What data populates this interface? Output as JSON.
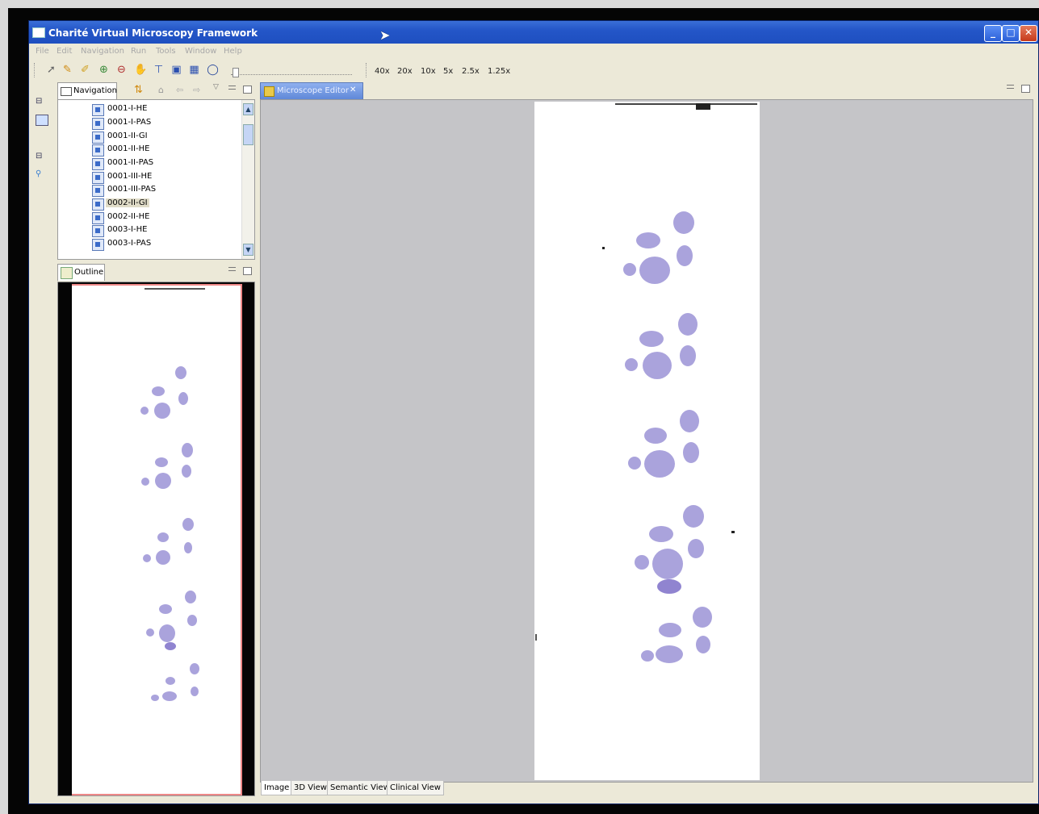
{
  "window": {
    "title": "Charité Virtual Microscopy Framework",
    "controls": {
      "minimize": "_",
      "maximize": "□",
      "close": "✕"
    }
  },
  "menu": [
    "File",
    "Edit",
    "Navigation",
    "Run",
    "Tools",
    "Window",
    "Help"
  ],
  "toolbar": {
    "icons": [
      "select-arrow-icon",
      "pencil-icon",
      "multi-pencil-icon",
      "zoom-in-icon",
      "zoom-out-icon",
      "hand-pan-icon",
      "stamp-icon",
      "layers-icon",
      "grid-icon",
      "circle-icon"
    ],
    "magnifications": [
      "40x",
      "20x",
      "10x",
      "5x",
      "2.5x",
      "1.25x"
    ]
  },
  "navigation": {
    "tab_label": "Navigation",
    "items": [
      "0001-I-HE",
      "0001-I-PAS",
      "0001-II-GI",
      "0001-II-HE",
      "0001-II-PAS",
      "0001-III-HE",
      "0001-III-PAS",
      "0002-II-GI",
      "0002-II-HE",
      "0003-I-HE",
      "0003-I-PAS"
    ],
    "selected": "0002-II-GI"
  },
  "outline": {
    "tab_label": "Outline"
  },
  "editor": {
    "tab_label": "Microscope Editor",
    "bottom_tabs": [
      "Image",
      "3D View",
      "Semantic View",
      "Clinical View"
    ]
  },
  "colors": {
    "titlebar": "#2456c8",
    "tissue_stain": "#9b93d6",
    "editor_bg": "#c5c5c8"
  }
}
